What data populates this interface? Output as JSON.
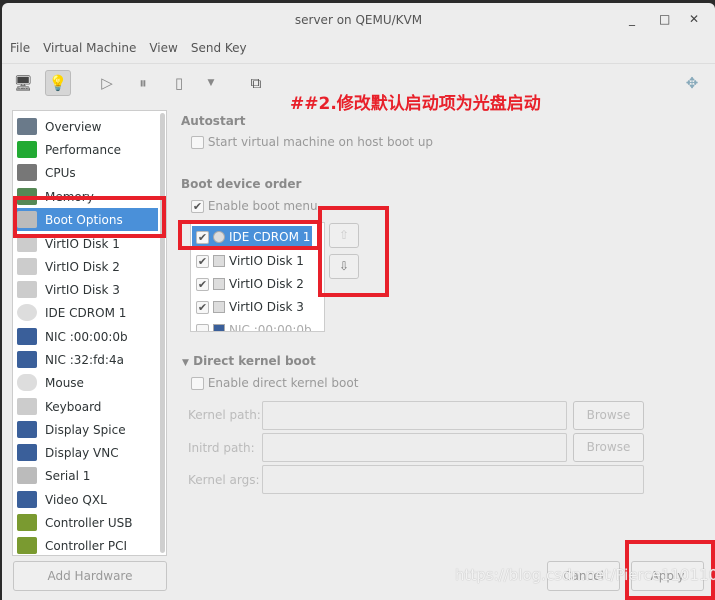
{
  "window": {
    "title": "server on QEMU/KVM",
    "minimize": "_",
    "maximize": "□",
    "close": "✕"
  },
  "menu": [
    "File",
    "Virtual Machine",
    "View",
    "Send Key"
  ],
  "toolbar": {
    "icons": [
      "console-icon",
      "details-icon",
      "run-icon",
      "pause-icon",
      "shutdown-icon",
      "dropdown-icon",
      "snapshots-icon",
      "fullscreen-icon"
    ]
  },
  "annotation": "##2.修改默认启动项为光盘启动",
  "sidebar": {
    "items": [
      {
        "label": "Overview"
      },
      {
        "label": "Performance"
      },
      {
        "label": "CPUs"
      },
      {
        "label": "Memory"
      },
      {
        "label": "Boot Options"
      },
      {
        "label": "VirtIO Disk 1"
      },
      {
        "label": "VirtIO Disk 2"
      },
      {
        "label": "VirtIO Disk 3"
      },
      {
        "label": "IDE CDROM 1"
      },
      {
        "label": "NIC :00:00:0b"
      },
      {
        "label": "NIC :32:fd:4a"
      },
      {
        "label": "Mouse"
      },
      {
        "label": "Keyboard"
      },
      {
        "label": "Display Spice"
      },
      {
        "label": "Display VNC"
      },
      {
        "label": "Serial 1"
      },
      {
        "label": "Video QXL"
      },
      {
        "label": "Controller USB"
      },
      {
        "label": "Controller PCI"
      }
    ],
    "selected": "Boot Options",
    "add_hardware": "Add Hardware"
  },
  "autostart": {
    "heading": "Autostart",
    "checkbox": "Start virtual machine on host boot up",
    "checked": false
  },
  "boot": {
    "heading": "Boot device order",
    "enable_menu": "Enable boot menu",
    "enable_menu_checked": true,
    "devices": [
      {
        "label": "IDE CDROM 1",
        "checked": true
      },
      {
        "label": "VirtIO Disk 1",
        "checked": true
      },
      {
        "label": "VirtIO Disk 2",
        "checked": true
      },
      {
        "label": "VirtIO Disk 3",
        "checked": true
      },
      {
        "label": "NIC :00:00:0b",
        "checked": false
      }
    ],
    "up": "⇧",
    "down": "⇩"
  },
  "kernel": {
    "heading": "Direct kernel boot",
    "enable": "Enable direct kernel boot",
    "kernel_path": "Kernel path:",
    "initrd_path": "Initrd path:",
    "kernel_args": "Kernel args:",
    "browse": "Browse"
  },
  "footer": {
    "cancel": "Cancel",
    "apply": "Apply"
  },
  "watermark": "https://blog.csdn.net/Pierce110110"
}
